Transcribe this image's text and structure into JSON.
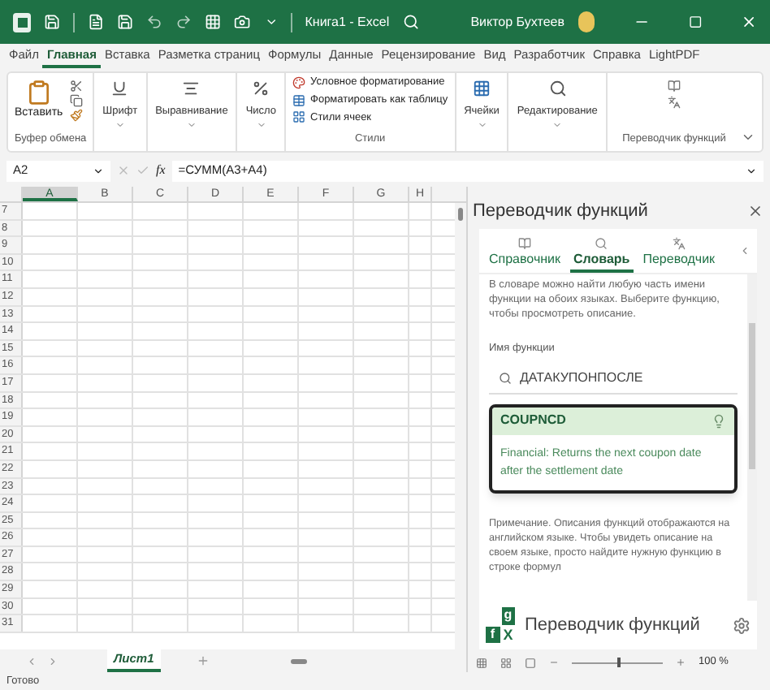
{
  "window": {
    "title": "Книга1  -  Excel",
    "user": "Виктор Бухтеев"
  },
  "ribbon_tabs": [
    {
      "label": "Файл",
      "selected": false
    },
    {
      "label": "Главная",
      "selected": true
    },
    {
      "label": "Вставка",
      "selected": false
    },
    {
      "label": "Разметка страниц",
      "selected": false
    },
    {
      "label": "Формулы",
      "selected": false
    },
    {
      "label": "Данные",
      "selected": false
    },
    {
      "label": "Рецензирование",
      "selected": false
    },
    {
      "label": "Вид",
      "selected": false
    },
    {
      "label": "Разработчик",
      "selected": false
    },
    {
      "label": "Справка",
      "selected": false
    },
    {
      "label": "LightPDF",
      "selected": false
    }
  ],
  "ribbon": {
    "clipboard": {
      "paste": "Вставить",
      "label": "Буфер обмена"
    },
    "font": "Шрифт",
    "alignment": "Выравнивание",
    "number": "Число",
    "styles": {
      "items": [
        "Условное форматирование",
        "Форматировать как таблицу",
        "Стили ячеек"
      ],
      "label": "Стили"
    },
    "cells": "Ячейки",
    "editing": "Редактирование",
    "translator_label": "Переводчик функций"
  },
  "formula_bar": {
    "name_box": "A2",
    "function_icon": "fx",
    "formula": "=СУММ(A3+A4)"
  },
  "sheet": {
    "columns": [
      {
        "label": "A",
        "selected": true
      },
      {
        "label": "B",
        "selected": false
      },
      {
        "label": "C",
        "selected": false
      },
      {
        "label": "D",
        "selected": false
      },
      {
        "label": "E",
        "selected": false
      },
      {
        "label": "F",
        "selected": false
      },
      {
        "label": "G",
        "selected": false
      },
      {
        "label": "H",
        "selected": false
      }
    ],
    "rows": [
      "7",
      "8",
      "9",
      "10",
      "11",
      "12",
      "13",
      "14",
      "15",
      "16",
      "17",
      "18",
      "19",
      "20",
      "21",
      "22",
      "23",
      "24",
      "25",
      "26",
      "27",
      "28",
      "29",
      "30",
      "31"
    ]
  },
  "pane": {
    "title": "Переводчик функций",
    "tabs": [
      {
        "label": "Справочник",
        "selected": false
      },
      {
        "label": "Словарь",
        "selected": true
      },
      {
        "label": "Переводчик",
        "selected": false
      }
    ],
    "intro": "В словаре можно найти любую часть имени функции на обоих языках. Выберите функцию, чтобы просмотреть описание.",
    "field_label": "Имя функции",
    "search_value": "ДАТАКУПОНПОСЛЕ",
    "result": {
      "name": "COUPNCD",
      "description": "Financial: Returns the next coupon date after the settlement date"
    },
    "note": "Примечание. Описания функций отображаются на английском языке. Чтобы увидеть описание на своем языке, просто найдите нужную функцию в строке формул",
    "logo": {
      "top": "g",
      "left": "f",
      "right": "X"
    },
    "footer": "Переводчик функций"
  },
  "sheet_tabs": [
    {
      "label": "Лист1",
      "selected": true
    }
  ],
  "status_bar": {
    "text": "Готово",
    "zoom": "100 %",
    "level": 0.5
  }
}
